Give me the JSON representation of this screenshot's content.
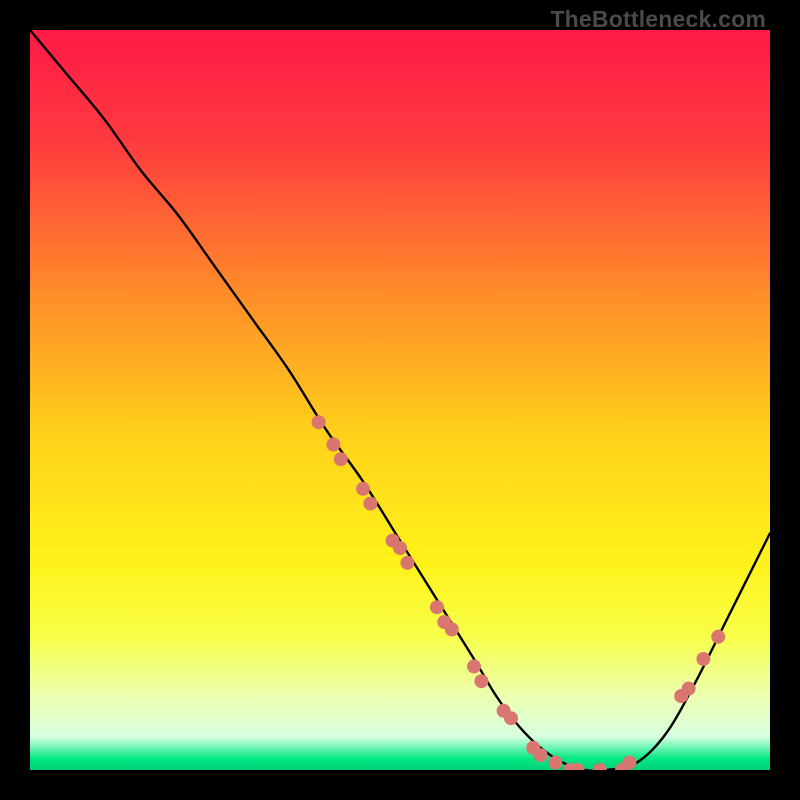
{
  "watermark": "TheBottleneck.com",
  "chart_data": {
    "type": "line",
    "title": "",
    "xlabel": "",
    "ylabel": "",
    "xlim": [
      0,
      100
    ],
    "ylim": [
      0,
      100
    ],
    "gradient_stops": [
      {
        "pos": 0,
        "color": "#ff1a47"
      },
      {
        "pos": 0.15,
        "color": "#ff3a3f"
      },
      {
        "pos": 0.35,
        "color": "#ff8a2a"
      },
      {
        "pos": 0.55,
        "color": "#ffd21a"
      },
      {
        "pos": 0.72,
        "color": "#fff21a"
      },
      {
        "pos": 0.82,
        "color": "#f7ff4a"
      },
      {
        "pos": 0.9,
        "color": "#ecffb0"
      },
      {
        "pos": 0.955,
        "color": "#d7ffe0"
      },
      {
        "pos": 0.985,
        "color": "#00e884"
      },
      {
        "pos": 1.0,
        "color": "#00cf76"
      }
    ],
    "series": [
      {
        "name": "bottleneck-curve",
        "x": [
          0,
          5,
          10,
          15,
          20,
          25,
          30,
          35,
          40,
          45,
          50,
          55,
          60,
          63,
          66,
          69,
          72,
          75,
          78,
          82,
          86,
          90,
          94,
          98,
          100
        ],
        "y": [
          100,
          94,
          88,
          81,
          75,
          68,
          61,
          54,
          46,
          39,
          31,
          23,
          15,
          10,
          6,
          3,
          1,
          0,
          0,
          1,
          5,
          12,
          20,
          28,
          32
        ]
      }
    ],
    "markers": {
      "name": "highlight-points",
      "color": "#d8766f",
      "radius": 7,
      "points": [
        {
          "x": 39,
          "y": 47
        },
        {
          "x": 41,
          "y": 44
        },
        {
          "x": 42,
          "y": 42
        },
        {
          "x": 45,
          "y": 38
        },
        {
          "x": 46,
          "y": 36
        },
        {
          "x": 49,
          "y": 31
        },
        {
          "x": 50,
          "y": 30
        },
        {
          "x": 51,
          "y": 28
        },
        {
          "x": 55,
          "y": 22
        },
        {
          "x": 56,
          "y": 20
        },
        {
          "x": 57,
          "y": 19
        },
        {
          "x": 60,
          "y": 14
        },
        {
          "x": 61,
          "y": 12
        },
        {
          "x": 64,
          "y": 8
        },
        {
          "x": 65,
          "y": 7
        },
        {
          "x": 68,
          "y": 3
        },
        {
          "x": 69,
          "y": 2
        },
        {
          "x": 71,
          "y": 1
        },
        {
          "x": 73,
          "y": 0
        },
        {
          "x": 74,
          "y": 0
        },
        {
          "x": 77,
          "y": 0
        },
        {
          "x": 80,
          "y": 0
        },
        {
          "x": 81,
          "y": 1
        },
        {
          "x": 88,
          "y": 10
        },
        {
          "x": 89,
          "y": 11
        },
        {
          "x": 91,
          "y": 15
        },
        {
          "x": 93,
          "y": 18
        }
      ]
    }
  }
}
